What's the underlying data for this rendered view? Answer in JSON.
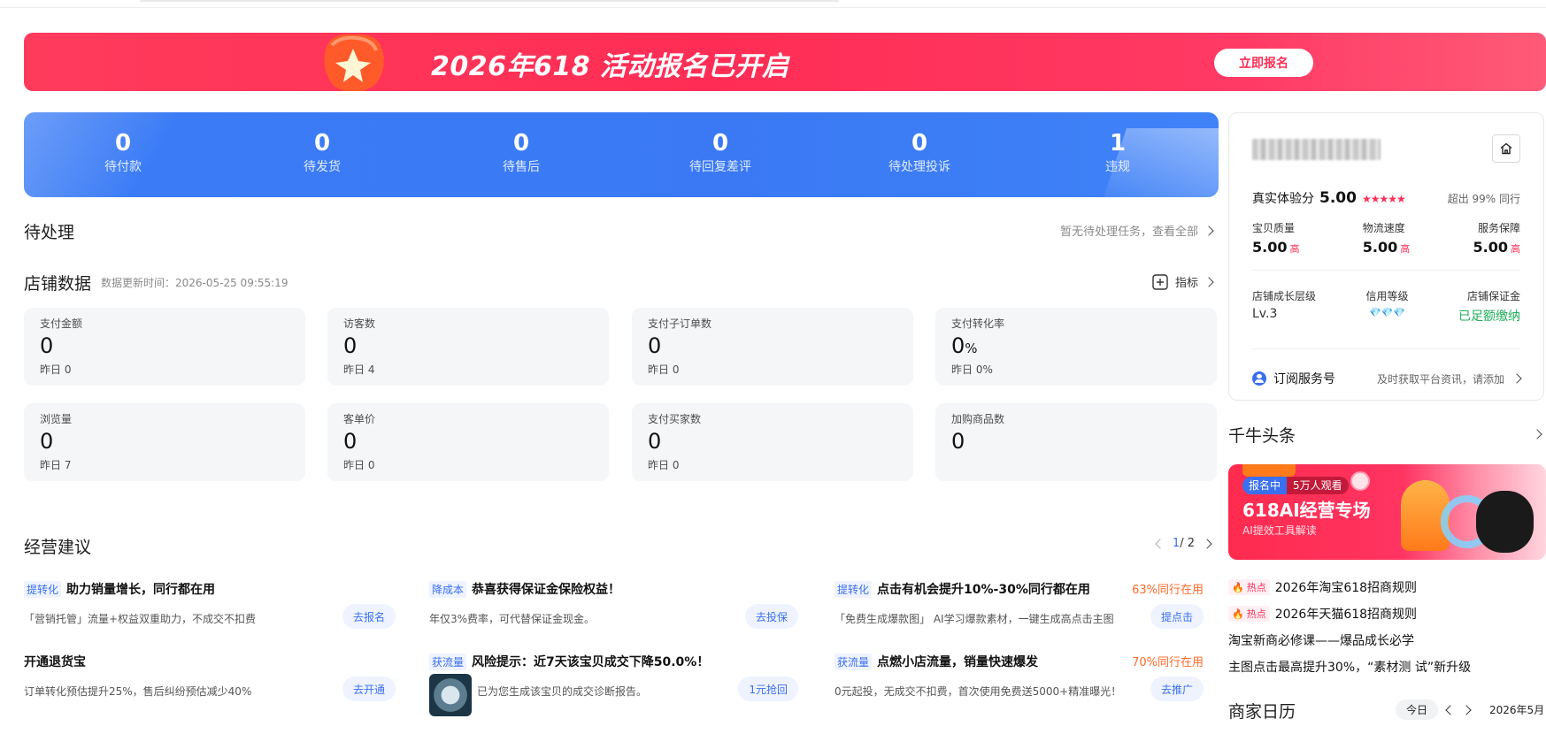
{
  "banner": {
    "title": "2026年618 活动报名已开启",
    "button": "立即报名"
  },
  "stats": [
    {
      "value": "0",
      "label": "待付款"
    },
    {
      "value": "0",
      "label": "待发货"
    },
    {
      "value": "0",
      "label": "待售后"
    },
    {
      "value": "0",
      "label": "待回复差评"
    },
    {
      "value": "0",
      "label": "待处理投诉"
    },
    {
      "value": "1",
      "label": "违规"
    }
  ],
  "pending": {
    "title": "待处理",
    "link": "暂无待处理任务，查看全部"
  },
  "shop_data": {
    "title": "店铺数据",
    "updated": "数据更新时间：2026-05-25 09:55:19",
    "metrics_link": "指标",
    "cards": [
      {
        "title": "支付金额",
        "value": "0",
        "unit": "",
        "yesterday": "昨日 0"
      },
      {
        "title": "访客数",
        "value": "0",
        "unit": "",
        "yesterday": "昨日 4"
      },
      {
        "title": "支付子订单数",
        "value": "0",
        "unit": "",
        "yesterday": "昨日 0"
      },
      {
        "title": "支付转化率",
        "value": "0",
        "unit": "%",
        "yesterday": "昨日 0%"
      },
      {
        "title": "浏览量",
        "value": "0",
        "unit": "",
        "yesterday": "昨日 7"
      },
      {
        "title": "客单价",
        "value": "0",
        "unit": "",
        "yesterday": "昨日 0"
      },
      {
        "title": "支付买家数",
        "value": "0",
        "unit": "",
        "yesterday": "昨日 0"
      },
      {
        "title": "加购商品数",
        "value": "0",
        "unit": "",
        "yesterday": ""
      }
    ]
  },
  "advice": {
    "title": "经营建议",
    "page": "1",
    "total": "/ 2",
    "items": [
      {
        "tag": "提转化",
        "title": "助力销量增长，同行都在用",
        "rate": "",
        "desc": "「营销托管」流量+权益双重助力，不成交不扣费",
        "button": "去报名"
      },
      {
        "tag": "降成本",
        "title": "恭喜获得保证金保险权益！",
        "rate": "",
        "desc": "年仅3%费率，可代替保证金现金。",
        "button": "去投保"
      },
      {
        "tag": "提转化",
        "title": "点击有机会提升10%-30%同行都在用",
        "rate": "63%同行在用",
        "desc": "「免费生成爆款图」 AI学习爆款素材，一键生成高点击主图",
        "button": "提点击"
      },
      {
        "tag": "",
        "title": "开通退货宝",
        "rate": "",
        "desc": "订单转化预估提升25%，售后纠纷预估减少40%",
        "button": "去开通"
      },
      {
        "tag": "获流量",
        "title": "风险提示：近7天该宝贝成交下降50.0%！",
        "rate": "",
        "desc": "已为您生成该宝贝的成交诊断报告。",
        "button": "1元抢回"
      },
      {
        "tag": "获流量",
        "title": "点燃小店流量，销量快速爆发",
        "rate": "70%同行在用",
        "desc": "0元起投，无成交不扣费，首次使用免费送5000+精准曝光！",
        "button": "去推广"
      }
    ]
  },
  "profile": {
    "score_label": "真实体验分",
    "score": "5.00",
    "stars": "★★★★★",
    "percentile": "超出 99% 同行",
    "ratings": [
      {
        "label": "宝贝质量",
        "value": "5.00",
        "level": "高"
      },
      {
        "label": "物流速度",
        "value": "5.00",
        "level": "高"
      },
      {
        "label": "服务保障",
        "value": "5.00",
        "level": "高"
      }
    ],
    "growth_label": "店铺成长层级",
    "growth_value": "Lv.3",
    "credit_label": "信用等级",
    "credit_value": "💎💎💎",
    "deposit_label": "店铺保证金",
    "deposit_value": "已足额缴纳",
    "subscribe_label": "订阅服务号",
    "subscribe_hint": "及时获取平台资讯，请添加"
  },
  "headlines": {
    "title": "千牛头条",
    "ad": {
      "live": "报名中",
      "viewers": "5万人观看",
      "title": "618AI经营专场",
      "subtitle": "AI提效工具解读"
    },
    "items": [
      {
        "hot": "热点",
        "text": "2026年淘宝618招商规则"
      },
      {
        "hot": "热点",
        "text": "2026年天猫618招商规则"
      },
      {
        "hot": "",
        "text": "淘宝新商必修课——爆品成长必学"
      },
      {
        "hot": "",
        "text": "主图点击最高提升30%，“素材测 试”新升级"
      }
    ]
  },
  "calendar": {
    "title": "商家日历",
    "today": "今日",
    "month": "2026年5月"
  },
  "colors": {
    "brand_blue": "#3b7cf6",
    "banner_red": "#ff2d55",
    "rate_orange": "#ff6a2b",
    "deposit_green": "#1fae5b"
  }
}
